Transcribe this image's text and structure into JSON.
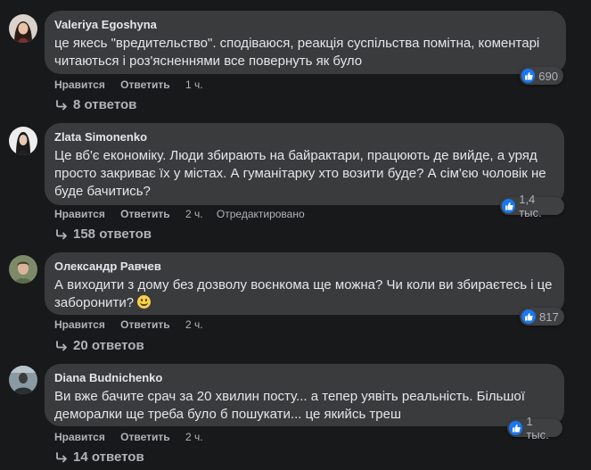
{
  "comments": [
    {
      "author": "Valeriya Egoshyna",
      "lines": [
        "це якесь \"вредительство\". сподіваюся, реакція суспільства помітна, коментарі",
        "читаються і роз'ясненнями все повернуть як було"
      ],
      "reactions": "690",
      "like": "Нравится",
      "reply": "Ответить",
      "time": "1 ч.",
      "edited": "",
      "replies": "8 ответов"
    },
    {
      "author": "Zlata Simonenko",
      "lines": [
        "Це вб'є економіку. Люди збирають на байрактари, працюють де вийде, а уряд",
        "просто закриває їх у містах. А гуманітарку хто возити буде? А сім'єю чоловік не",
        "буде бачитись?"
      ],
      "reactions": "1,4 тыс.",
      "like": "Нравится",
      "reply": "Ответить",
      "time": "2 ч.",
      "edited": "Отредактировано",
      "replies": "158 ответов"
    },
    {
      "author": "Олександр Равчев",
      "lines": [
        "А виходити з дому без дозволу воєнкома ще можна? Чи коли ви збираєтесь і це",
        "заборонити?"
      ],
      "reactions": "817",
      "like": "Нравится",
      "reply": "Ответить",
      "time": "2 ч.",
      "edited": "",
      "replies": "20 ответов"
    },
    {
      "author": "Diana Budnichenko",
      "lines": [
        "Ви вже бачите срач за 20 хвилин посту... а тепер уявіть реальність. Більшої",
        "деморалки ще треба було б пошукати... це якийсь треш"
      ],
      "reactions": "1 тыс.",
      "like": "Нравится",
      "reply": "Ответить",
      "time": "2 ч.",
      "edited": "",
      "replies": "14 ответов"
    }
  ],
  "colors": {
    "like_blue": "#1877f2",
    "bubble": "#3a3b3c",
    "background": "#18191a"
  }
}
